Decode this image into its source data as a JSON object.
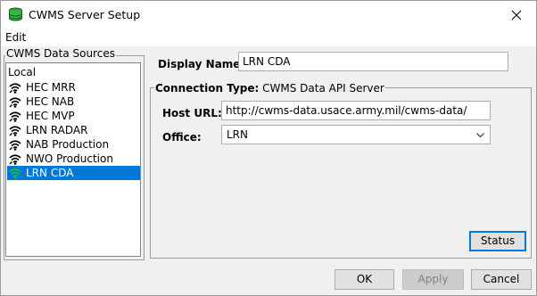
{
  "window": {
    "title": "CWMS Server Setup"
  },
  "menubar": {
    "edit_label": "Edit"
  },
  "data_sources": {
    "legend": "CWMS Data Sources",
    "local_label": "Local",
    "items": [
      {
        "label": "HEC MRR",
        "icon": "wifi-signal-icon",
        "selected": false
      },
      {
        "label": "HEC NAB",
        "icon": "wifi-signal-icon",
        "selected": false
      },
      {
        "label": "HEC MVP",
        "icon": "wifi-signal-icon",
        "selected": false
      },
      {
        "label": "LRN RADAR",
        "icon": "wifi-signal-icon",
        "selected": false
      },
      {
        "label": "NAB Production",
        "icon": "wifi-signal-icon",
        "selected": false
      },
      {
        "label": "NWO Production",
        "icon": "wifi-signal-icon",
        "selected": false
      },
      {
        "label": "LRN CDA",
        "icon": "wifi-signal-green-icon",
        "selected": true
      }
    ]
  },
  "details": {
    "display_name_label": "Display Name:",
    "display_name_value": "LRN CDA",
    "connection_type_label": "Connection Type:",
    "connection_type_value": "CWMS Data API Server",
    "host_url_label": "Host URL:",
    "host_url_value": "http://cwms-data.usace.army.mil/cwms-data/",
    "office_label": "Office:",
    "office_value": "LRN",
    "status_button": "Status"
  },
  "footer": {
    "ok_button": "OK",
    "apply_button": "Apply",
    "cancel_button": "Cancel"
  },
  "colors": {
    "selection": "#0078d7",
    "wifi_selected": "#22c12c",
    "wifi_default": "#000000"
  }
}
